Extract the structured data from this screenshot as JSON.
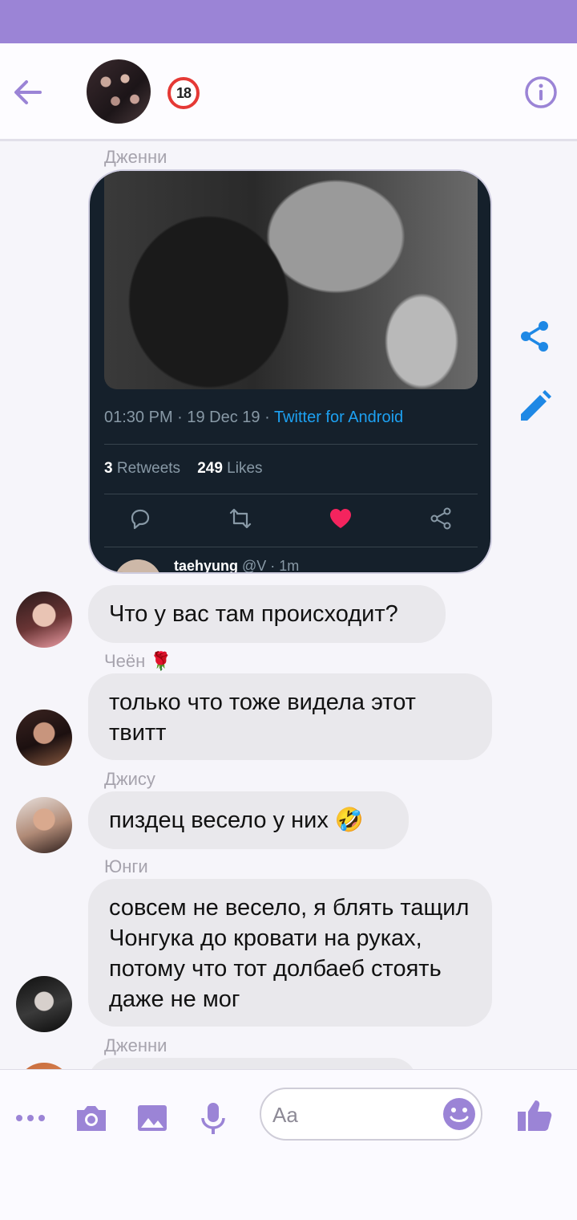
{
  "header": {
    "age_badge": "18"
  },
  "tweet": {
    "sender": "Дженни",
    "time": "01:30 PM · 19 Dec 19 · ",
    "source": "Twitter for Android",
    "retweets_count": "3",
    "retweets_label": " Retweets",
    "likes_count": "249",
    "likes_label": " Likes",
    "reply_name": "taehyung",
    "reply_handle": " @V · 1m"
  },
  "messages": [
    {
      "text": "Что у вас там происходит?"
    },
    {
      "sender": "Чеён 🌹",
      "text": "только что тоже видела этот твитт"
    },
    {
      "sender": "Джису",
      "text": "пиздец весело у них 🤣"
    },
    {
      "sender": "Юнги",
      "text": "совсем не весело, я блять тащил Чонгука до кровати на руках, потому что тот долбаеб стоять даже не мог"
    },
    {
      "sender": "Дженни"
    }
  ],
  "composer": {
    "placeholder": "Aa"
  },
  "colors": {
    "accent": "#9b84d6",
    "action_blue": "#1e88e5",
    "bubble_bg": "#e9e8ec",
    "tweet_bg": "#15202b",
    "twitter_blue": "#1da1f2",
    "like_red": "#f4245e"
  }
}
